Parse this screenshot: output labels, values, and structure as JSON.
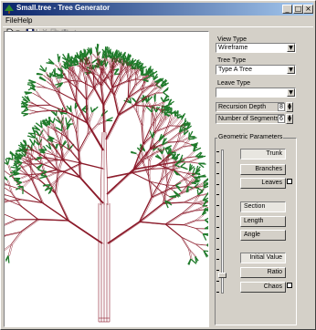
{
  "window": {
    "title": "Small.tree - Tree Generator"
  },
  "menu": [
    {
      "label": "File"
    },
    {
      "label": "Help"
    }
  ],
  "toolbar": {
    "icons": [
      "new-file-icon",
      "open-folder-icon",
      "save-disk-icon",
      "cut-icon",
      "copy-icon",
      "paste-icon",
      "undo-icon"
    ]
  },
  "controls": {
    "view_type": {
      "label": "View Type",
      "value": "Wireframe"
    },
    "tree_type": {
      "label": "Tree Type",
      "value": "Type A Tree"
    },
    "leave_type": {
      "label": "Leave Type",
      "value": ""
    },
    "recursion_depth": {
      "label": "Recursion Depth",
      "value": "8"
    },
    "number_of_segments": {
      "label": "Number of Segments",
      "value": "6"
    }
  },
  "geometric": {
    "title": "Geometric Parameters",
    "slider_value": 0.12,
    "buttons": [
      {
        "label": "Trunk",
        "align": "right",
        "sunk": true,
        "check": false
      },
      {
        "label": "Branches",
        "align": "right",
        "sunk": false,
        "check": false
      },
      {
        "label": "Leaves",
        "align": "right",
        "sunk": false,
        "check": true
      },
      {
        "label": "Section",
        "align": "left",
        "sunk": true,
        "check": false
      },
      {
        "label": "Length",
        "align": "left",
        "sunk": false,
        "check": false
      },
      {
        "label": "Angle",
        "align": "left",
        "sunk": false,
        "check": false
      },
      {
        "label": "Initial Value",
        "align": "right",
        "sunk": true,
        "check": false
      },
      {
        "label": "Ratio",
        "align": "right",
        "sunk": false,
        "check": false
      },
      {
        "label": "Chaos",
        "align": "right",
        "sunk": false,
        "check": true
      }
    ]
  },
  "colors": {
    "branch": "#8b1a2a",
    "leaf": "#1f7a2a",
    "title_start": "#0a246a",
    "title_end": "#a6caf0"
  }
}
